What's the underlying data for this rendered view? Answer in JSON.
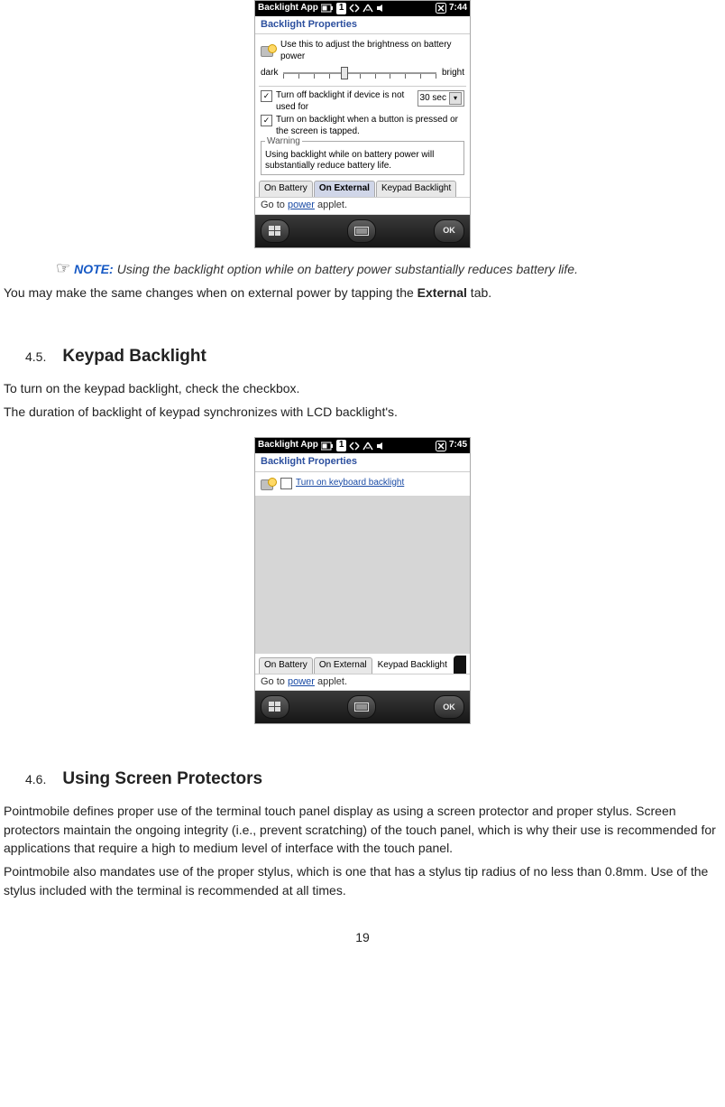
{
  "shot1": {
    "status": {
      "app": "Backlight App",
      "badge": "1",
      "time": "7:44"
    },
    "title": "Backlight Properties",
    "brightness_desc": "Use this to adjust the brightness on battery power",
    "slider": {
      "left": "dark",
      "right": "bright"
    },
    "opt_timeout": "Turn off backlight if device is not used for",
    "timeout_value": "30 sec",
    "opt_tap": "Turn on backlight when a button is pressed or the screen is tapped.",
    "warning_legend": "Warning",
    "warning_body": "Using backlight while on battery power will substantially reduce battery life.",
    "tabs": {
      "t1": "On Battery",
      "t2": "On External",
      "t3": "Keypad Backlight"
    },
    "goto_pre": "Go to ",
    "goto_link": "power",
    "goto_post": " applet.",
    "ok": "OK"
  },
  "note": {
    "label": "NOTE:",
    "text": "Using the backlight option while on battery power substantially reduces battery life."
  },
  "para1_pre": "You may make the same changes when on external power by tapping the ",
  "para1_bold": "External",
  "para1_post": " tab.",
  "sec45": {
    "num": "4.5.",
    "title": "Keypad Backlight"
  },
  "p45a": "To turn on the keypad backlight, check the checkbox.",
  "p45b": "The duration of backlight of keypad synchronizes with LCD backlight's.",
  "shot2": {
    "status": {
      "app": "Backlight App",
      "badge": "1",
      "time": "7:45"
    },
    "title": "Backlight Properties",
    "opt_kb": "Turn on keyboard backlight",
    "tabs": {
      "t1": "On Battery",
      "t2": "On External",
      "t3": "Keypad Backlight"
    },
    "goto_pre": "Go to ",
    "goto_link": "power",
    "goto_post": " applet.",
    "ok": "OK"
  },
  "sec46": {
    "num": "4.6.",
    "title": "Using Screen Protectors"
  },
  "p46a": "Pointmobile defines proper use of the terminal touch panel display as using a screen protector and proper stylus. Screen protectors maintain the ongoing integrity (i.e., prevent scratching) of the touch panel, which is why their use is recommended for applications that require a high to medium level of interface with the touch panel.",
  "p46b": "Pointmobile also mandates use of the proper stylus, which is one that has a stylus tip radius of no less than 0.8mm. Use of the stylus included with the terminal is recommended at all times.",
  "page_number": "19"
}
